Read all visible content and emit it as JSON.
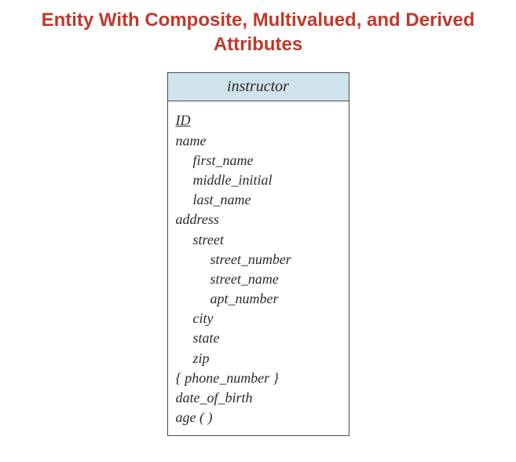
{
  "title": "Entity With Composite, Multivalued, and Derived Attributes",
  "entity": {
    "name": "instructor",
    "attributes": [
      {
        "text": "ID",
        "indent": 0,
        "underline": true
      },
      {
        "text": "name",
        "indent": 0,
        "underline": false
      },
      {
        "text": "first_name",
        "indent": 1,
        "underline": false
      },
      {
        "text": "middle_initial",
        "indent": 1,
        "underline": false
      },
      {
        "text": "last_name",
        "indent": 1,
        "underline": false
      },
      {
        "text": "address",
        "indent": 0,
        "underline": false
      },
      {
        "text": "street",
        "indent": 1,
        "underline": false
      },
      {
        "text": "street_number",
        "indent": 2,
        "underline": false
      },
      {
        "text": "street_name",
        "indent": 2,
        "underline": false
      },
      {
        "text": "apt_number",
        "indent": 2,
        "underline": false
      },
      {
        "text": "city",
        "indent": 1,
        "underline": false
      },
      {
        "text": "state",
        "indent": 1,
        "underline": false
      },
      {
        "text": "zip",
        "indent": 1,
        "underline": false
      },
      {
        "text": "{ phone_number }",
        "indent": 0,
        "underline": false
      },
      {
        "text": "date_of_birth",
        "indent": 0,
        "underline": false
      },
      {
        "text": "age ( )",
        "indent": 0,
        "underline": false
      }
    ]
  }
}
